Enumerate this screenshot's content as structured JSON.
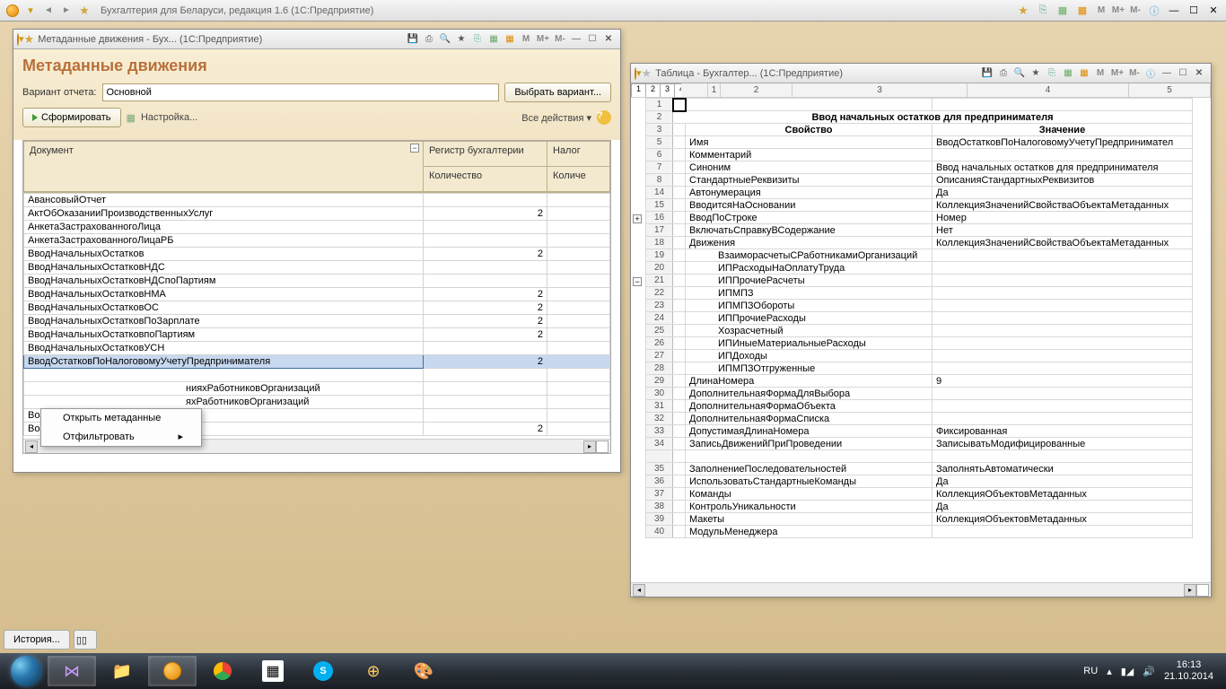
{
  "app": {
    "title": "Бухгалтерия для Беларуси, редакция 1.6  (1С:Предприятие)"
  },
  "win_left": {
    "title": "Метаданные движения - Бух...  (1С:Предприятие)",
    "heading": "Метаданные движения",
    "variant_label": "Вариант отчета:",
    "variant_value": "Основной",
    "select_variant": "Выбрать вариант...",
    "form_btn": "Сформировать",
    "settings": "Настройка...",
    "all_actions": "Все действия",
    "columns": {
      "doc": "Документ",
      "reg": "Регистр бухгалтерии",
      "nalog": "Налог",
      "qty": "Количество",
      "qty2": "Количе"
    },
    "rows": [
      {
        "doc": "АвансовыйОтчет",
        "q": ""
      },
      {
        "doc": "АктОбОказанииПроизводственныхУслуг",
        "q": "2"
      },
      {
        "doc": "АнкетаЗастрахованногоЛица",
        "q": ""
      },
      {
        "doc": "АнкетаЗастрахованногоЛицаРБ",
        "q": ""
      },
      {
        "doc": "ВводНачальныхОстатков",
        "q": "2"
      },
      {
        "doc": "ВводНачальныхОстатковНДС",
        "q": ""
      },
      {
        "doc": "ВводНачальныхОстатковНДСпоПартиям",
        "q": ""
      },
      {
        "doc": "ВводНачальныхОстатковНМА",
        "q": "2"
      },
      {
        "doc": "ВводНачальныхОстатковОС",
        "q": "2"
      },
      {
        "doc": "ВводНачальныхОстатковПоЗарплате",
        "q": "2"
      },
      {
        "doc": "ВводНачальныхОстатковпоПартиям",
        "q": "2"
      },
      {
        "doc": "ВводНачальныхОстатковУСН",
        "q": ""
      },
      {
        "doc": "ВводОстатковПоНалоговомуУчетуПредпринимателя",
        "q": "2",
        "sel": true
      },
      {
        "doc": "",
        "q": ""
      },
      {
        "doc": "",
        "q": "",
        "tail": "нияхРаботниковОрганизаций"
      },
      {
        "doc": "",
        "q": "",
        "tail": "яхРаботниковОрганизаций"
      },
      {
        "doc": "ВозвратМатериаловИзЭксплуатации",
        "q": ""
      },
      {
        "doc": "ВозвратТоваровОтПокупателя",
        "q": "2"
      }
    ],
    "context": {
      "open_meta": "Открыть метаданные",
      "filter": "Отфильтровать"
    }
  },
  "win_right": {
    "title": "Таблица - Бухгалтер...  (1С:Предприятие)",
    "doc_title": "Ввод начальных остатков для предпринимателя",
    "h_prop": "Свойство",
    "h_val": "Значение",
    "rows": [
      {
        "n": "1",
        "p": "",
        "v": ""
      },
      {
        "n": "2",
        "p": "__TITLE__",
        "v": ""
      },
      {
        "n": "3",
        "p": "__HEADER__",
        "v": ""
      },
      {
        "n": "5",
        "p": "Имя",
        "v": "ВводОстатковПоНалоговомуУчетуПредпринимател"
      },
      {
        "n": "6",
        "p": "Комментарий",
        "v": ""
      },
      {
        "n": "7",
        "p": "Синоним",
        "v": "Ввод начальных остатков для предпринимателя"
      },
      {
        "n": "8",
        "p": "СтандартныеРеквизиты",
        "v": "ОписанияСтандартныхРеквизитов"
      },
      {
        "n": "14",
        "p": "Автонумерация",
        "v": "Да"
      },
      {
        "n": "15",
        "p": "ВводитсяНаОсновании",
        "v": "КоллекцияЗначенийСвойстваОбъектаМетаданных"
      },
      {
        "n": "16",
        "p": "ВводПоСтроке",
        "v": "Номер"
      },
      {
        "n": "17",
        "p": "ВключатьСправкуВСодержание",
        "v": "Нет"
      },
      {
        "n": "18",
        "p": "Движения",
        "v": "КоллекцияЗначенийСвойстваОбъектаМетаданных"
      },
      {
        "n": "19",
        "p": "ВзаиморасчетыСРаботникамиОрганизаций",
        "v": "",
        "i": 1
      },
      {
        "n": "20",
        "p": "ИПРасходыНаОплатуТруда",
        "v": "",
        "i": 1
      },
      {
        "n": "21",
        "p": "ИППрочиеРасчеты",
        "v": "",
        "i": 1
      },
      {
        "n": "22",
        "p": "ИПМПЗ",
        "v": "",
        "i": 1
      },
      {
        "n": "23",
        "p": "ИПМПЗОбороты",
        "v": "",
        "i": 1
      },
      {
        "n": "24",
        "p": "ИППрочиеРасходы",
        "v": "",
        "i": 1
      },
      {
        "n": "25",
        "p": "Хозрасчетный",
        "v": "",
        "i": 1
      },
      {
        "n": "26",
        "p": "ИПИныеМатериальныеРасходы",
        "v": "",
        "i": 1
      },
      {
        "n": "27",
        "p": "ИПДоходы",
        "v": "",
        "i": 1
      },
      {
        "n": "28",
        "p": "ИПМПЗОтгруженные",
        "v": "",
        "i": 1
      },
      {
        "n": "29",
        "p": "ДлинаНомера",
        "v": "9"
      },
      {
        "n": "30",
        "p": "ДополнительнаяФормаДляВыбора",
        "v": ""
      },
      {
        "n": "31",
        "p": "ДополнительнаяФормаОбъекта",
        "v": ""
      },
      {
        "n": "32",
        "p": "ДополнительнаяФормаСписка",
        "v": ""
      },
      {
        "n": "33",
        "p": "ДопустимаяДлинаНомера",
        "v": "Фиксированная"
      },
      {
        "n": "34",
        "p": "ЗаписьДвиженийПриПроведении",
        "v": "ЗаписыватьМодифицированные"
      },
      {
        "n": "",
        "p": "",
        "v": ""
      },
      {
        "n": "35",
        "p": "ЗаполнениеПоследовательностей",
        "v": "ЗаполнятьАвтоматически"
      },
      {
        "n": "36",
        "p": "ИспользоватьСтандартныеКоманды",
        "v": "Да"
      },
      {
        "n": "37",
        "p": "Команды",
        "v": "КоллекцияОбъектовМетаданных"
      },
      {
        "n": "38",
        "p": "КонтрольУникальности",
        "v": "Да"
      },
      {
        "n": "39",
        "p": "Макеты",
        "v": "КоллекцияОбъектовМетаданных"
      },
      {
        "n": "40",
        "p": "МодульМенеджера",
        "v": ""
      }
    ]
  },
  "bottom_bar": {
    "history": "История..."
  },
  "tray": {
    "lang": "RU",
    "time": "16:13",
    "date": "21.10.2014"
  }
}
